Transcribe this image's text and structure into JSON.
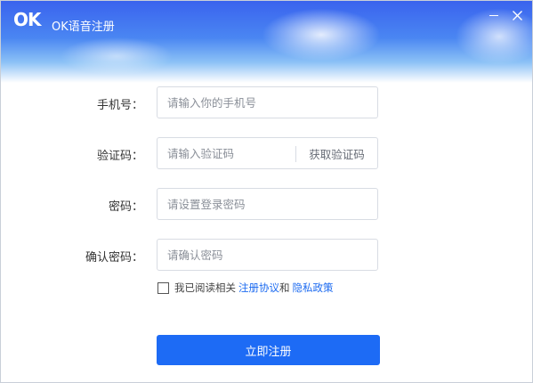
{
  "header": {
    "logo": "OK",
    "title": "OK语音注册",
    "minimize_icon": "minimize-icon",
    "close_icon": "close-icon",
    "close_glyph": "✕"
  },
  "form": {
    "phone": {
      "label": "手机号：",
      "placeholder": "请输入你的手机号",
      "value": ""
    },
    "code": {
      "label": "验证码：",
      "placeholder": "请输入验证码",
      "value": "",
      "button_label": "获取验证码"
    },
    "password": {
      "label": "密码：",
      "placeholder": "请设置登录密码",
      "value": ""
    },
    "confirm": {
      "label": "确认密码：",
      "placeholder": "请确认密码",
      "value": ""
    }
  },
  "agreement": {
    "checked": false,
    "prefix": "我已阅读相关",
    "terms_link": "注册协议",
    "conjunction": "和",
    "privacy_link": "隐私政策"
  },
  "submit_label": "立即注册",
  "colors": {
    "accent": "#1d6bf5",
    "link": "#1d6bf0",
    "header_top": "#3a63ee"
  }
}
